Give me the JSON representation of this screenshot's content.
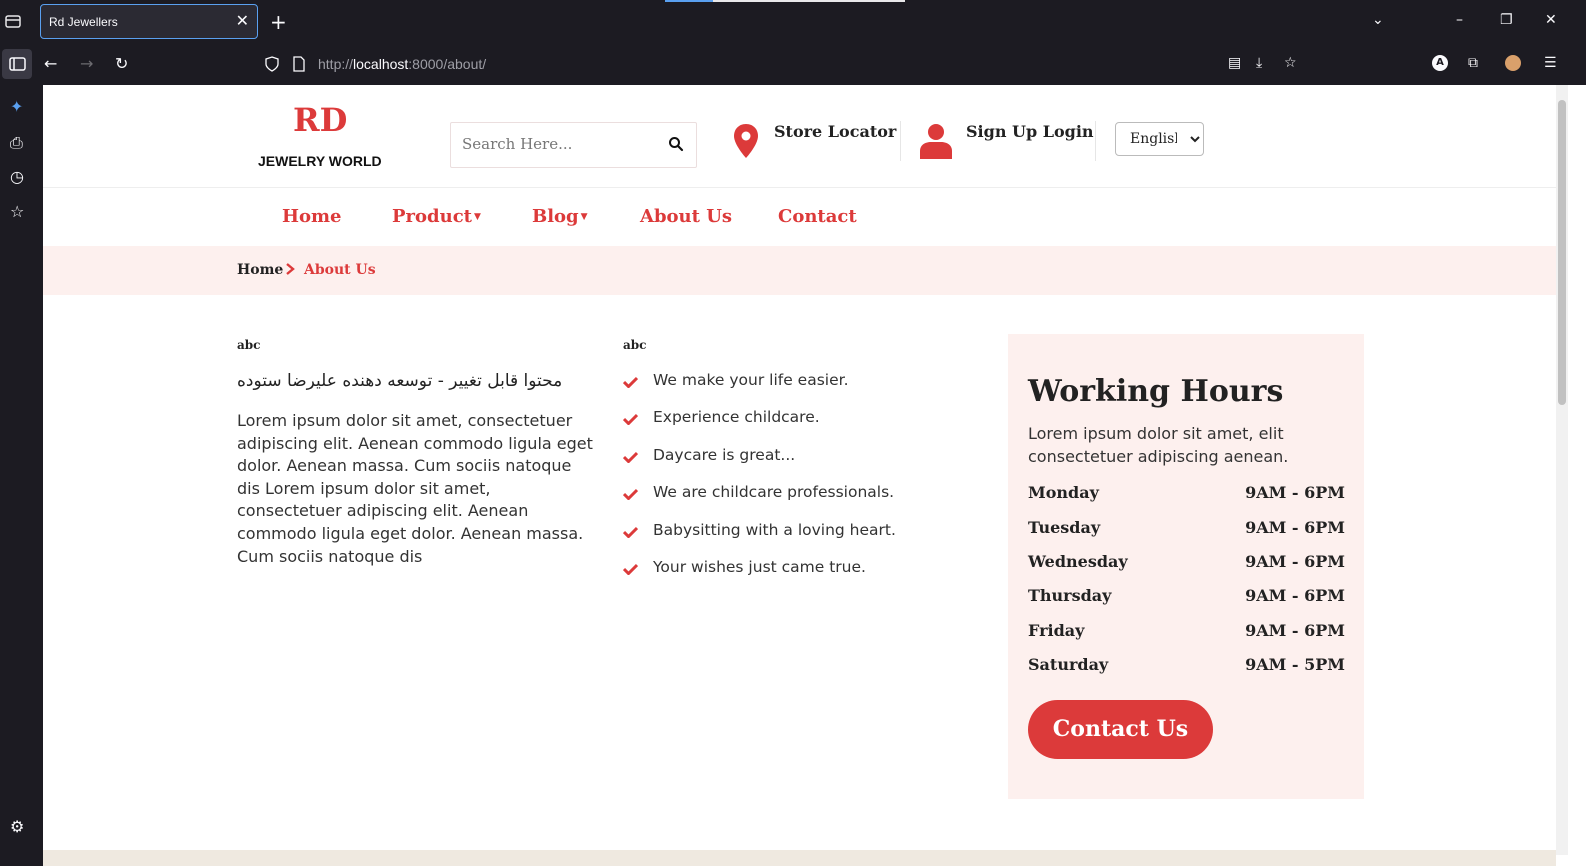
{
  "browser": {
    "tab_title": "Rd Jewellers",
    "tab_close": "✕",
    "new_tab": "+",
    "url_scheme": "http://",
    "url_host": "localhost",
    "url_path": ":8000/about/"
  },
  "header": {
    "logo_main": "RD",
    "logo_sub": "JEWELRY WORLD",
    "search_placeholder": "Search Here...",
    "store_locator": "Store Locator",
    "signup_login": "Sign Up Login",
    "language_selected": "English"
  },
  "menu": {
    "items": [
      {
        "label": "Home",
        "has_dropdown": false
      },
      {
        "label": "Product",
        "has_dropdown": true
      },
      {
        "label": "Blog",
        "has_dropdown": true
      },
      {
        "label": "About Us",
        "has_dropdown": false
      },
      {
        "label": "Contact",
        "has_dropdown": false
      }
    ]
  },
  "breadcrumb": {
    "home": "Home",
    "current": "About Us"
  },
  "content": {
    "left_tag": "abc",
    "arabic_heading": "محتوا قابل تغییر - توسعه دهنده علیرضا ستوده",
    "lorem": "Lorem ipsum dolor sit amet, consectetuer adipiscing elit. Aenean commodo ligula eget dolor. Aenean massa. Cum sociis natoque dis Lorem ipsum dolor sit amet, consectetuer adipiscing elit. Aenean commodo ligula eget dolor. Aenean massa. Cum sociis natoque dis",
    "right_tag": "abc",
    "checklist": [
      "We make your life easier.",
      "Experience childcare.",
      "Daycare is great...",
      "We are childcare professionals.",
      "Babysitting with a loving heart.",
      "Your wishes just came true."
    ]
  },
  "working_hours": {
    "title": "Working Hours",
    "description": "Lorem ipsum dolor sit amet, elit consectetuer adipiscing aenean.",
    "rows": [
      {
        "day": "Monday",
        "time": "9AM - 6PM"
      },
      {
        "day": "Tuesday",
        "time": "9AM - 6PM"
      },
      {
        "day": "Wednesday",
        "time": "9AM - 6PM"
      },
      {
        "day": "Thursday",
        "time": "9AM - 6PM"
      },
      {
        "day": "Friday",
        "time": "9AM - 6PM"
      },
      {
        "day": "Saturday",
        "time": "9AM - 5PM"
      }
    ],
    "button": "Contact Us"
  },
  "colors": {
    "accent": "#dc3a3a",
    "soft_bg": "#fdf0ee",
    "chrome_bg": "#1c1b22"
  }
}
